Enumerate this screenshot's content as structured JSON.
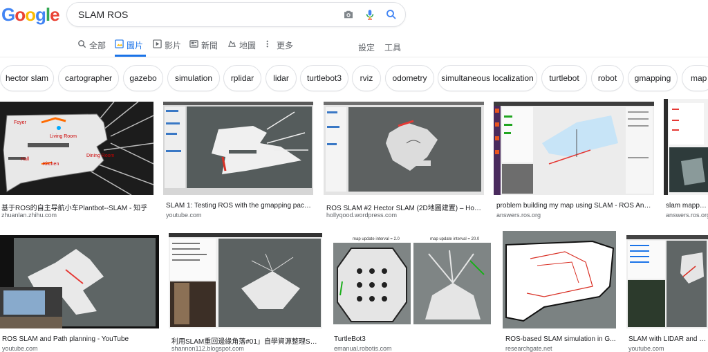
{
  "logo": {
    "letters": [
      "G",
      "o",
      "o",
      "g",
      "l",
      "e"
    ]
  },
  "search": {
    "value": "SLAM ROS"
  },
  "tabs": [
    {
      "label": "全部"
    },
    {
      "label": "圖片"
    },
    {
      "label": "影片"
    },
    {
      "label": "新聞"
    },
    {
      "label": "地圖"
    },
    {
      "label": "更多"
    }
  ],
  "tools": {
    "settings": "設定",
    "tools": "工具"
  },
  "chips": [
    "hector slam",
    "cartographer",
    "gazebo",
    "simulation",
    "rplidar",
    "lidar",
    "turtlebot3",
    "rviz",
    "odometry",
    "simultaneous localization",
    "turtlebot",
    "robot",
    "gmapping",
    "map"
  ],
  "results": [
    {
      "title": "基于ROS的自主导航小车Plantbot--SLAM - 知乎",
      "source": "zhuanlan.zhihu.com"
    },
    {
      "title": "SLAM 1: Testing ROS with the gmapping packa...",
      "source": "youtube.com"
    },
    {
      "title": "ROS SLAM #2 Hector SLAM (2D地圖建置) – Holly...",
      "source": "hollyqood.wordpress.com"
    },
    {
      "title": "problem building my map using SLAM - ROS Ans...",
      "source": "answers.ros.org"
    },
    {
      "title": "slam mapping",
      "source": "answers.ros.org"
    },
    {
      "title": "ROS SLAM and Path planning - YouTube",
      "source": "youtube.com"
    },
    {
      "title": "利用SLAM重回邊緣角落#01」自學資源整理SLA...",
      "source": "shannon112.blogspot.com"
    },
    {
      "title": "TurtleBot3",
      "source": "emanual.robotis.com"
    },
    {
      "title": "ROS-based SLAM simulation in G...",
      "source": "researchgate.net"
    },
    {
      "title": "SLAM with LIDAR and whe",
      "source": "youtube.com"
    }
  ],
  "thumb_text": {
    "r0": [
      "Foyer",
      "Living Room",
      "Hall",
      "Kitchen",
      "Dining Room"
    ],
    "r7": [
      "map update interval = 2.0",
      "map update interval = 20.0"
    ]
  },
  "colors": {
    "accent": "#1a73e8",
    "logo": [
      "#4285f4",
      "#ea4335",
      "#fbbc05",
      "#4285f4",
      "#34a853",
      "#ea4335"
    ]
  }
}
